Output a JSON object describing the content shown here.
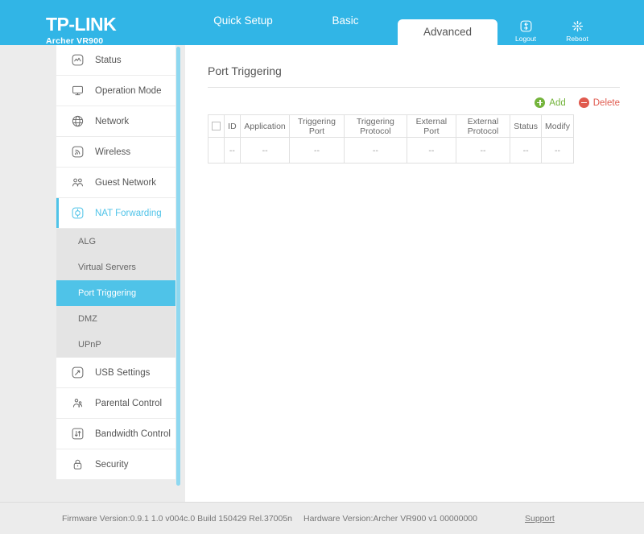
{
  "header": {
    "brand": "TP-LINK",
    "model": "Archer VR900",
    "tabs": [
      {
        "label": "Quick Setup",
        "active": false
      },
      {
        "label": "Basic",
        "active": false
      },
      {
        "label": "Advanced",
        "active": true
      }
    ],
    "actions": [
      {
        "label": "Logout",
        "icon": "logout-icon"
      },
      {
        "label": "Reboot",
        "icon": "reboot-icon"
      }
    ],
    "brand_color": "#31b5e6"
  },
  "sidebar": {
    "items": [
      {
        "label": "Status",
        "icon": "status-icon",
        "active": false
      },
      {
        "label": "Operation Mode",
        "icon": "monitor-icon",
        "active": false
      },
      {
        "label": "Network",
        "icon": "globe-icon",
        "active": false
      },
      {
        "label": "Wireless",
        "icon": "wireless-icon",
        "active": false
      },
      {
        "label": "Guest Network",
        "icon": "guest-network-icon",
        "active": false
      },
      {
        "label": "NAT Forwarding",
        "icon": "nat-forwarding-icon",
        "active": true
      },
      {
        "label": "USB Settings",
        "icon": "usb-icon",
        "active": false
      },
      {
        "label": "Parental Control",
        "icon": "parental-control-icon",
        "active": false
      },
      {
        "label": "Bandwidth Control",
        "icon": "bandwidth-icon",
        "active": false
      },
      {
        "label": "Security",
        "icon": "lock-icon",
        "active": false
      }
    ],
    "submenu": [
      {
        "label": "ALG",
        "active": false
      },
      {
        "label": "Virtual Servers",
        "active": false
      },
      {
        "label": "Port Triggering",
        "active": true
      },
      {
        "label": "DMZ",
        "active": false
      },
      {
        "label": "UPnP",
        "active": false
      }
    ],
    "active_color": "#4fc3e8"
  },
  "main": {
    "title": "Port Triggering",
    "add_label": "Add",
    "delete_label": "Delete",
    "table": {
      "columns": [
        "",
        "ID",
        "Application",
        "Triggering Port",
        "Triggering Protocol",
        "External Port",
        "External Protocol",
        "Status",
        "Modify"
      ],
      "rows": [
        [
          "",
          "--",
          "--",
          "--",
          "--",
          "--",
          "--",
          "--",
          "--"
        ]
      ]
    },
    "add_color": "#74b43c",
    "delete_color": "#e05a4e"
  },
  "footer": {
    "firmware": "Firmware Version:0.9.1 1.0 v004c.0 Build 150429 Rel.37005n",
    "hardware": "Hardware Version:Archer VR900 v1 00000000",
    "support": "Support"
  }
}
